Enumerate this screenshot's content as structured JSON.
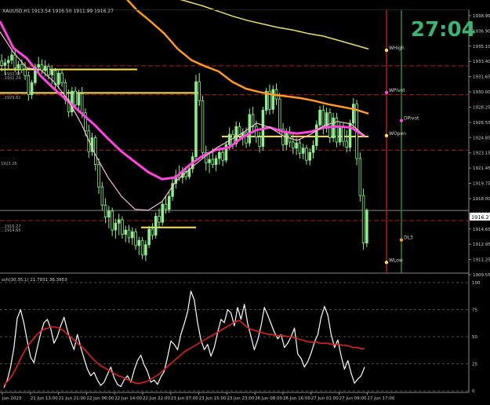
{
  "window": {
    "title": "XAUUSD,H1",
    "ohlc": "1913.54 1916.50 1911.99 1916.27",
    "countdown": "27:04"
  },
  "price_axis": {
    "ticks": [
      "1938.99",
      "1936.90",
      "1935.10",
      "1933.40",
      "1931.65",
      "1930.00",
      "1928.25",
      "1926.55",
      "1924.85",
      "1923.15",
      "1921.45",
      "1919.75",
      "1918.00",
      "1916.30",
      "1914.65",
      "1912.95",
      "1911.25",
      "1909.55"
    ],
    "current_price": "1916.27",
    "range": [
      1909.0,
      1939.5
    ]
  },
  "time_axis": {
    "labels": [
      "Jun 2023",
      "21 Jun 13:00",
      "21 Jun 21:00",
      "22 Jun 06:00",
      "22 Jun 14:00",
      "22 Jun 22:00",
      "23 Jun 07:00",
      "23 Jun 15:00",
      "23 Jun 23:00",
      "26 Jun 08:00",
      "26 Jun 16:00",
      "27 Jun 01:00",
      "27 Jun 09:00",
      "27 Jun 17:00"
    ]
  },
  "pivot_labels": {
    "whigh": "WHigh",
    "wpivot": "WPivot",
    "dpivot": "DPivot",
    "wopen": "WOpen",
    "dl3": "DL3",
    "wlow": "WLow"
  },
  "left_labels": {
    "l1": "...1932.63",
    "l2": "...1932.24",
    "l3": "...1929.61",
    "l4": "1923.26",
    "l5": "...1916.27",
    "l6": "...1914.65"
  },
  "oscillator": {
    "label": "sch(30,35,1) 21.7931 36.3953",
    "levels": [
      "100",
      "75",
      "50",
      "25",
      "0"
    ],
    "range": [
      0,
      100
    ]
  },
  "colors": {
    "background": "#000000",
    "bull_candle": "#90EE90",
    "bear_candle": "#000000",
    "ma_fast": "#FF44DD",
    "ma_pink": "#F5C0C8",
    "ma_orange": "#FF9922",
    "ma_yellow": "#E8E06A",
    "level_yellow": "#FFE34A",
    "pivot_red": "#B01C1C",
    "vline_green": "#2E8B2E",
    "countdown": "#3CB371",
    "osc_white": "#FFFFFF",
    "osc_red": "#E02020"
  },
  "chart_data": {
    "type": "candlestick",
    "symbol": "XAUUSD",
    "timeframe": "H1",
    "candles": [
      [
        1933.6,
        1934.4,
        1932.4,
        1933.1
      ],
      [
        1933.1,
        1933.9,
        1932.0,
        1933.4
      ],
      [
        1933.4,
        1934.2,
        1932.6,
        1933.7
      ],
      [
        1933.7,
        1935.0,
        1933.2,
        1934.3
      ],
      [
        1934.3,
        1934.9,
        1932.3,
        1932.8
      ],
      [
        1932.8,
        1933.6,
        1932.0,
        1933.2
      ],
      [
        1933.2,
        1933.8,
        1932.2,
        1932.6
      ],
      [
        1932.6,
        1933.5,
        1931.4,
        1931.9
      ],
      [
        1931.9,
        1932.4,
        1929.0,
        1929.7
      ],
      [
        1929.7,
        1931.4,
        1929.2,
        1931.1
      ],
      [
        1931.1,
        1933.3,
        1930.8,
        1932.9
      ],
      [
        1932.9,
        1934.1,
        1932.3,
        1933.2
      ],
      [
        1933.2,
        1933.8,
        1932.1,
        1932.5
      ],
      [
        1932.5,
        1933.7,
        1931.8,
        1933.0
      ],
      [
        1933.0,
        1933.3,
        1931.5,
        1932.0
      ],
      [
        1932.0,
        1933.1,
        1930.9,
        1932.5
      ],
      [
        1932.5,
        1932.8,
        1930.4,
        1930.9
      ],
      [
        1930.9,
        1932.6,
        1930.4,
        1932.2
      ],
      [
        1932.2,
        1932.7,
        1930.6,
        1931.1
      ],
      [
        1931.1,
        1931.5,
        1928.6,
        1929.1
      ],
      [
        1929.1,
        1930.3,
        1927.1,
        1927.7
      ],
      [
        1927.7,
        1930.6,
        1927.2,
        1930.1
      ],
      [
        1930.1,
        1930.6,
        1928.0,
        1928.5
      ],
      [
        1928.5,
        1930.3,
        1927.6,
        1929.8
      ],
      [
        1929.8,
        1930.6,
        1927.0,
        1927.6
      ],
      [
        1927.6,
        1928.1,
        1924.9,
        1925.5
      ],
      [
        1925.5,
        1926.2,
        1922.4,
        1923.1
      ],
      [
        1923.1,
        1925.3,
        1922.6,
        1924.7
      ],
      [
        1924.7,
        1925.0,
        1920.9,
        1921.6
      ],
      [
        1921.6,
        1922.3,
        1918.2,
        1919.0
      ],
      [
        1919.0,
        1919.6,
        1916.3,
        1916.9
      ],
      [
        1916.9,
        1917.7,
        1914.8,
        1915.5
      ],
      [
        1915.5,
        1916.8,
        1914.2,
        1916.2
      ],
      [
        1916.2,
        1916.6,
        1913.3,
        1914.0
      ],
      [
        1914.0,
        1915.3,
        1913.0,
        1914.8
      ],
      [
        1914.8,
        1915.9,
        1913.4,
        1915.2
      ],
      [
        1915.2,
        1915.6,
        1913.0,
        1913.5
      ],
      [
        1913.5,
        1914.5,
        1912.6,
        1914.0
      ],
      [
        1914.0,
        1914.6,
        1912.5,
        1913.1
      ],
      [
        1913.1,
        1914.3,
        1912.3,
        1913.8
      ],
      [
        1913.8,
        1914.2,
        1911.7,
        1912.2
      ],
      [
        1912.2,
        1913.2,
        1911.1,
        1912.8
      ],
      [
        1912.8,
        1913.2,
        1910.6,
        1911.1
      ],
      [
        1911.1,
        1912.8,
        1910.4,
        1912.3
      ],
      [
        1912.3,
        1914.5,
        1911.9,
        1914.1
      ],
      [
        1914.1,
        1914.8,
        1912.9,
        1913.4
      ],
      [
        1913.4,
        1916.0,
        1913.0,
        1915.6
      ],
      [
        1915.6,
        1916.5,
        1914.4,
        1914.9
      ],
      [
        1914.9,
        1917.4,
        1914.5,
        1917.0
      ],
      [
        1917.0,
        1917.9,
        1915.9,
        1916.4
      ],
      [
        1916.4,
        1918.4,
        1916.0,
        1917.9
      ],
      [
        1917.9,
        1919.9,
        1917.4,
        1919.4
      ],
      [
        1919.4,
        1921.0,
        1918.8,
        1920.3
      ],
      [
        1920.3,
        1921.5,
        1919.7,
        1920.1
      ],
      [
        1920.1,
        1921.3,
        1919.4,
        1920.8
      ],
      [
        1920.8,
        1921.4,
        1919.8,
        1920.2
      ],
      [
        1920.2,
        1921.6,
        1919.9,
        1921.1
      ],
      [
        1921.1,
        1923.0,
        1920.6,
        1922.5
      ],
      [
        1922.5,
        1932.0,
        1922.0,
        1931.2
      ],
      [
        1931.2,
        1932.2,
        1928.4,
        1929.0
      ],
      [
        1929.0,
        1929.6,
        1922.3,
        1923.0
      ],
      [
        1923.0,
        1923.8,
        1920.9,
        1921.8
      ],
      [
        1921.8,
        1922.9,
        1920.6,
        1922.2
      ],
      [
        1922.2,
        1923.5,
        1921.2,
        1921.6
      ],
      [
        1921.6,
        1922.7,
        1920.8,
        1922.3
      ],
      [
        1922.3,
        1923.6,
        1921.6,
        1923.0
      ],
      [
        1923.0,
        1923.5,
        1921.4,
        1922.1
      ],
      [
        1922.1,
        1924.3,
        1921.8,
        1923.9
      ],
      [
        1923.9,
        1925.9,
        1923.3,
        1925.1
      ],
      [
        1925.1,
        1925.6,
        1923.4,
        1924.0
      ],
      [
        1924.0,
        1926.6,
        1923.6,
        1926.0
      ],
      [
        1926.0,
        1926.5,
        1924.4,
        1924.9
      ],
      [
        1924.9,
        1925.8,
        1923.8,
        1925.3
      ],
      [
        1925.3,
        1925.9,
        1923.5,
        1924.1
      ],
      [
        1924.1,
        1928.1,
        1923.7,
        1927.4
      ],
      [
        1927.4,
        1928.3,
        1925.3,
        1926.0
      ],
      [
        1926.0,
        1926.7,
        1924.1,
        1924.8
      ],
      [
        1924.8,
        1925.4,
        1923.0,
        1923.7
      ],
      [
        1923.7,
        1928.3,
        1923.2,
        1927.9
      ],
      [
        1927.9,
        1930.5,
        1927.4,
        1930.1
      ],
      [
        1930.1,
        1930.9,
        1927.4,
        1928.0
      ],
      [
        1928.0,
        1930.8,
        1927.5,
        1930.3
      ],
      [
        1930.3,
        1931.0,
        1928.5,
        1929.2
      ],
      [
        1929.2,
        1929.9,
        1925.1,
        1925.7
      ],
      [
        1925.7,
        1926.4,
        1923.2,
        1923.9
      ],
      [
        1923.9,
        1925.8,
        1923.3,
        1925.3
      ],
      [
        1925.3,
        1926.0,
        1923.6,
        1924.2
      ],
      [
        1924.2,
        1925.2,
        1922.8,
        1923.5
      ],
      [
        1923.5,
        1924.7,
        1922.7,
        1924.1
      ],
      [
        1924.1,
        1924.6,
        1922.3,
        1922.9
      ],
      [
        1922.9,
        1924.0,
        1922.2,
        1923.5
      ],
      [
        1923.5,
        1923.9,
        1921.6,
        1922.1
      ],
      [
        1922.1,
        1923.5,
        1921.5,
        1923.0
      ],
      [
        1923.0,
        1924.4,
        1922.3,
        1923.8
      ],
      [
        1923.8,
        1926.7,
        1923.3,
        1926.2
      ],
      [
        1926.2,
        1928.4,
        1925.7,
        1927.9
      ],
      [
        1927.9,
        1928.5,
        1925.1,
        1925.8
      ],
      [
        1925.8,
        1928.2,
        1925.3,
        1927.6
      ],
      [
        1927.6,
        1928.1,
        1924.1,
        1924.7
      ],
      [
        1924.7,
        1927.6,
        1924.2,
        1927.0
      ],
      [
        1927.0,
        1927.6,
        1923.6,
        1924.2
      ],
      [
        1924.2,
        1926.5,
        1923.8,
        1926.0
      ],
      [
        1926.0,
        1926.5,
        1923.7,
        1924.3
      ],
      [
        1924.3,
        1925.6,
        1923.0,
        1923.6
      ],
      [
        1923.6,
        1926.8,
        1923.1,
        1926.4
      ],
      [
        1926.4,
        1929.3,
        1925.8,
        1928.6
      ],
      [
        1928.6,
        1929.1,
        1921.5,
        1922.3
      ],
      [
        1922.3,
        1923.0,
        1917.3,
        1918.0
      ],
      [
        1918.0,
        1918.8,
        1911.7,
        1912.5
      ],
      [
        1912.5,
        1916.5,
        1912.0,
        1916.3
      ]
    ],
    "overlays": [
      {
        "name": "magenta",
        "color": "#FF44DD",
        "values": [
          1938.2,
          1935.1,
          1933.9,
          1931.9,
          1930.4,
          1929.0,
          1927.6,
          1926.2,
          1924.6,
          1923.1,
          1921.9,
          1920.7,
          1919.9,
          1920.1,
          1921.5,
          1922.6,
          1923.3,
          1923.6,
          1924.8,
          1925.6,
          1925.9,
          1925.4,
          1925.2,
          1925.4,
          1925.9,
          1926.0,
          1925.9,
          1924.9
        ]
      },
      {
        "name": "pink",
        "color": "#F5C0C8",
        "values": [
          1937.0,
          1934.6,
          1932.8,
          1932.6,
          1931.2,
          1929.2,
          1926.4,
          1922.9,
          1920.1,
          1917.9,
          1916.4,
          1916.3,
          1917.3,
          1919.6,
          1921.0,
          1922.3,
          1923.5,
          1924.4,
          1925.3,
          1926.4,
          1925.9,
          1924.9,
          1924.4,
          1925.1,
          1926.1,
          1926.6,
          1926.3,
          1924.9
        ]
      },
      {
        "name": "orange",
        "color": "#FF9922",
        "values": [
          1943.5,
          1941.2,
          1939.5,
          1938.2,
          1936.8,
          1935.0,
          1933.7,
          1933.0,
          1932.4,
          1931.2,
          1930.4,
          1930.0,
          1929.7,
          1929.5,
          1929.3,
          1929.0,
          1928.6,
          1928.3,
          1928.0,
          1927.5
        ]
      },
      {
        "name": "yellow",
        "color": "#E8E06A",
        "values": [
          1941.0,
          1940.5,
          1940.0,
          1939.4,
          1938.8,
          1938.3,
          1937.9,
          1937.5,
          1937.2,
          1936.8,
          1936.5,
          1936.0,
          1935.5,
          1935.0
        ]
      }
    ],
    "levels": [
      {
        "price": 1932.63,
        "color": "#FFE34A",
        "style": "solid"
      },
      {
        "price": 1929.91,
        "color": "#FFE34A",
        "style": "solid"
      },
      {
        "price": 1924.85,
        "color": "#FFE34A",
        "style": "solid"
      },
      {
        "price": 1914.3,
        "color": "#FFE34A",
        "style": "solid"
      },
      {
        "price": 1933.05,
        "color": "#B01C1C",
        "style": "dashed"
      },
      {
        "price": 1929.7,
        "color": "#B01C1C",
        "style": "dashed"
      },
      {
        "price": 1923.26,
        "color": "#B01C1C",
        "style": "dashed"
      },
      {
        "price": 1915.1,
        "color": "#B01C1C",
        "style": "dashed"
      },
      {
        "price": 1916.27,
        "color": "#888888",
        "style": "solid"
      }
    ],
    "pivots": [
      {
        "name": "WHigh",
        "price": 1934.85,
        "color": "#FFE34A"
      },
      {
        "name": "WPivot",
        "price": 1929.95,
        "color": "#FF44DD"
      },
      {
        "name": "DPivot",
        "price": 1926.7,
        "color": "#FF44DD"
      },
      {
        "name": "WOpen",
        "price": 1924.95,
        "color": "#FFE34A"
      },
      {
        "name": "DL3",
        "price": 1912.85,
        "color": "#FF9922"
      },
      {
        "name": "WLow",
        "price": 1910.25,
        "color": "#FFE34A"
      }
    ],
    "oscillator_series": [
      {
        "name": "white",
        "color": "#FFFFFF",
        "values": [
          3,
          10,
          22,
          40,
          67,
          75,
          62,
          46,
          31,
          26,
          40,
          53,
          63,
          66,
          58,
          44,
          50,
          60,
          68,
          56,
          46,
          38,
          52,
          40,
          30,
          20,
          14,
          17,
          10,
          5,
          8,
          15,
          22,
          12,
          6,
          4,
          10,
          14,
          8,
          19,
          28,
          33,
          24,
          18,
          8,
          10,
          6,
          13,
          18,
          31,
          46,
          43,
          38,
          52,
          62,
          73,
          92,
          84,
          63,
          47,
          38,
          43,
          32,
          40,
          54,
          66,
          63,
          75,
          72,
          60,
          77,
          66,
          80,
          62,
          50,
          38,
          47,
          60,
          77,
          70,
          62,
          54,
          48,
          52,
          40,
          44,
          50,
          58,
          34,
          30,
          22,
          27,
          35,
          45,
          52,
          68,
          78,
          70,
          52,
          40,
          47,
          32,
          20,
          28,
          16,
          7,
          11,
          14,
          22
        ]
      },
      {
        "name": "red",
        "color": "#E02020",
        "values": [
          5,
          9,
          13,
          19,
          26,
          33,
          39,
          44,
          48,
          52,
          55,
          57,
          58,
          59,
          59,
          58,
          56,
          53,
          50,
          47,
          44,
          41,
          38,
          34,
          30,
          27,
          24,
          22,
          20,
          18,
          16,
          14,
          13,
          11,
          10,
          8,
          7,
          7,
          8,
          9,
          11,
          13,
          15,
          18,
          21,
          24,
          27,
          30,
          33,
          36,
          38,
          40,
          42,
          44,
          46,
          48,
          50,
          52,
          54,
          56,
          58,
          60,
          62,
          64,
          65,
          62,
          59,
          57,
          56,
          55,
          54,
          53,
          52,
          52,
          51,
          51,
          51,
          50,
          50,
          49,
          48,
          47,
          46,
          45,
          45,
          45,
          44,
          44,
          44,
          43,
          43,
          43,
          42,
          42,
          41,
          40,
          40,
          39,
          39
        ]
      }
    ]
  }
}
